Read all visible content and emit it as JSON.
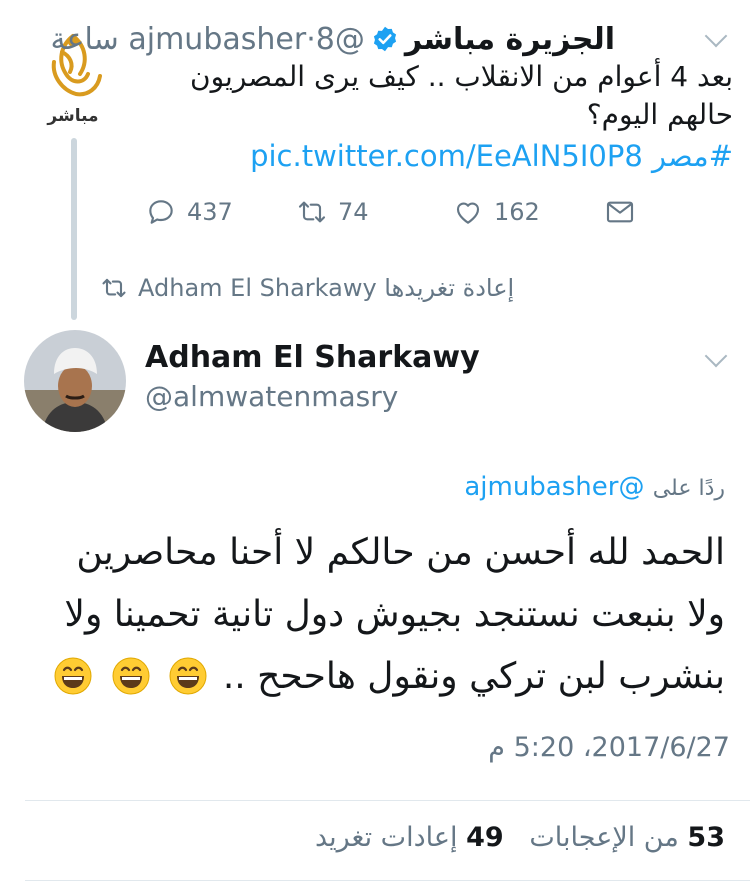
{
  "top_tweet": {
    "account_name": "الجزيرة مباشر",
    "handle": "@ajmubasher",
    "time_sep": "·",
    "time": "8 ساعة",
    "logo_label": "مباشر",
    "text": "بعد 4 أعوام من الانقلاب .. كيف يرى المصريون حالهم اليوم؟",
    "hashtag": "#مصر",
    "link": "pic.twitter.com/EeAlN5I0P8",
    "replies": "437",
    "retweets": "74",
    "likes": "162"
  },
  "retweet_context": {
    "label": "Adham El Sharkawy إعادة تغريدها"
  },
  "main_tweet": {
    "name": "Adham El Sharkawy",
    "handle": "@almwatenmasry",
    "reply_prefix": "ردًا على",
    "reply_handle": "@ajmubasher",
    "text_line1": "الحمد لله أحسن من حالكم لا أحنا محاصرين",
    "text_line2": "ولا بنبعت نستنجد بجيوش دول تانية تحمينا ولا",
    "text_line3": "بنشرب لبن تركي ونقول هاححح ..",
    "timestamp": "2017/6/27، 5:20 م",
    "retweets_count": "49",
    "retweets_label": "إعادات تغريد",
    "likes_count": "53",
    "likes_label": "من الإعجابات"
  },
  "colors": {
    "accent": "#1da1f2",
    "muted": "#657786",
    "logo_gold": "#d99b1f"
  },
  "icons": [
    "chevron-down-icon",
    "verified-icon",
    "reply-icon",
    "retweet-icon",
    "like-icon",
    "dm-icon",
    "grinning-emoji"
  ]
}
